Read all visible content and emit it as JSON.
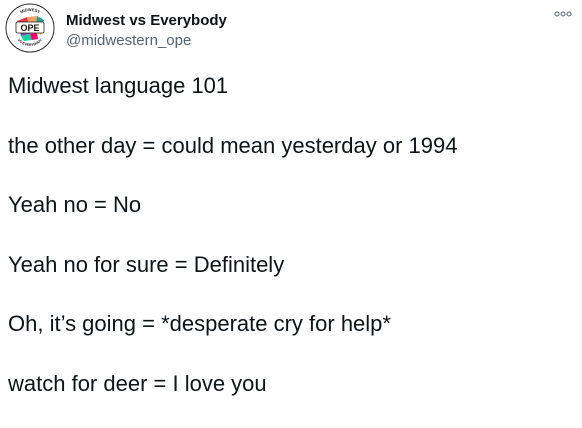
{
  "author": {
    "display_name": "Midwest vs Everybody",
    "handle": "@midwestern_ope",
    "avatar_icon": "ope-logo-avatar",
    "avatar_text": "OPE",
    "avatar_ring_top": "MIDWEST",
    "avatar_ring_bottom": "VS EVERYBODY"
  },
  "menu": {
    "icon": "more-options-icon"
  },
  "tweet": {
    "lines": [
      "Midwest language 101",
      "the other day = could mean yesterday or 1994",
      "Yeah no = No",
      "Yeah no for sure = Definitely",
      "Oh, it’s going = *desperate cry for help*",
      "watch for deer = I love you"
    ]
  },
  "colors": {
    "text": "#0f1419",
    "secondary_text": "#536471",
    "background": "#ffffff"
  }
}
